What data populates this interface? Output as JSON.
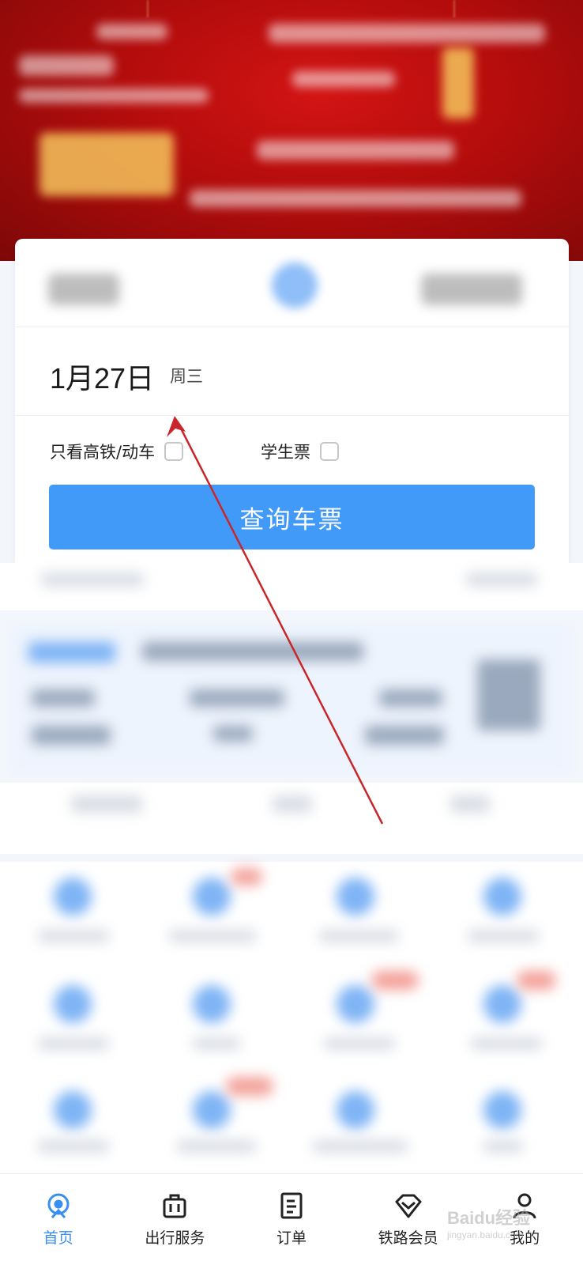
{
  "search": {
    "date": "1月27日",
    "weekday": "周三",
    "options": {
      "high_speed_label": "只看高铁/动车",
      "high_speed_checked": false,
      "student_label": "学生票",
      "student_checked": false
    },
    "query_button": "查询车票"
  },
  "bottom_nav": {
    "items": [
      {
        "label": "首页",
        "icon": "home-icon",
        "active": true
      },
      {
        "label": "出行服务",
        "icon": "luggage-icon",
        "active": false
      },
      {
        "label": "订单",
        "icon": "order-icon",
        "active": false
      },
      {
        "label": "铁路会员",
        "icon": "diamond-icon",
        "active": false
      },
      {
        "label": "我的",
        "icon": "user-icon",
        "active": false
      }
    ]
  },
  "watermark": {
    "text": "Baidu经验",
    "subtext": "jingyan.baidu.com"
  },
  "colors": {
    "primary": "#4199f8",
    "nav_active": "#3a8ef0",
    "banner_red": "#c91010",
    "annotation_arrow": "#c8262a"
  }
}
